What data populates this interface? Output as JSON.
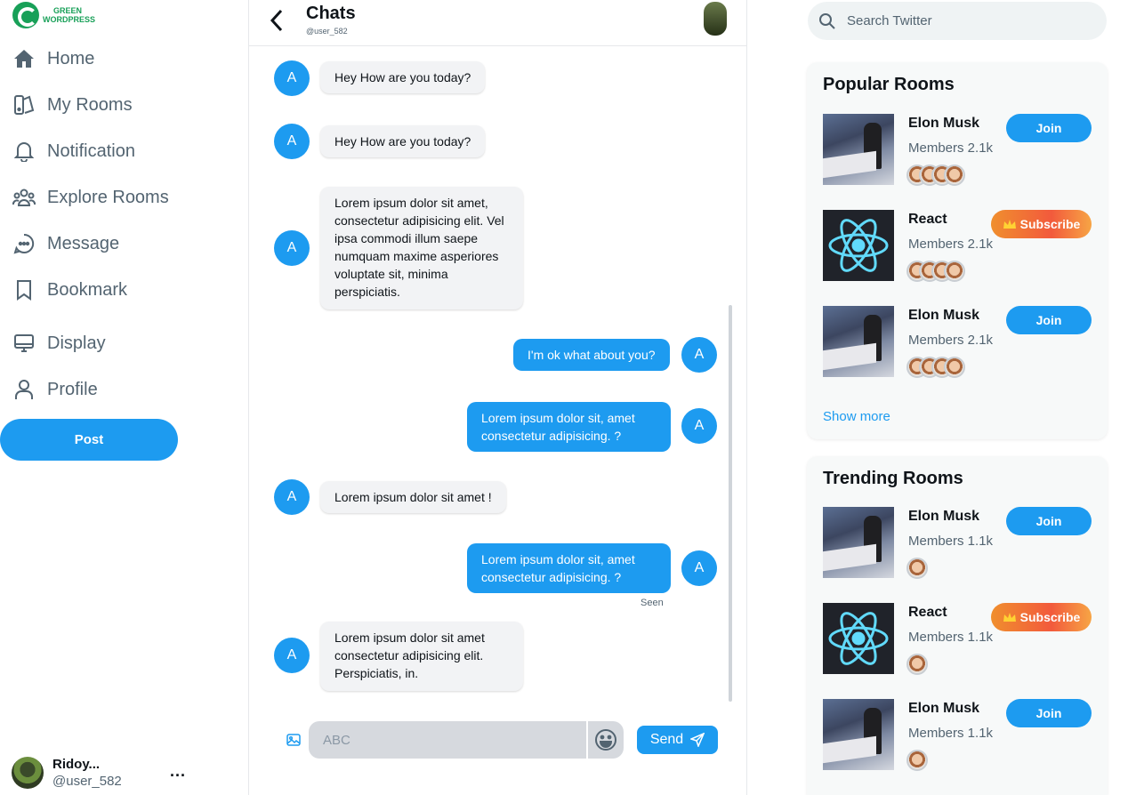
{
  "logo": {
    "line1": "GREEN",
    "line2": "WORDPRESS"
  },
  "nav": [
    {
      "label": "Home",
      "icon": "home-icon"
    },
    {
      "label": "My Rooms",
      "icon": "rooms-icon"
    },
    {
      "label": "Notification",
      "icon": "bell-icon"
    },
    {
      "label": "Explore Rooms",
      "icon": "people-icon"
    },
    {
      "label": "Message",
      "icon": "chat-bubble-icon"
    },
    {
      "label": "Bookmark",
      "icon": "bookmark-icon"
    },
    {
      "label": "Display",
      "icon": "monitor-icon"
    },
    {
      "label": "Profile",
      "icon": "user-icon"
    }
  ],
  "post_label": "Post",
  "me": {
    "name": "Ridoy...",
    "handle": "@user_582",
    "more": "..."
  },
  "chat": {
    "title": "Chats",
    "subtitle": "@user_582",
    "seen": "Seen",
    "messages": [
      {
        "side": "in",
        "avatar": "A",
        "text": "Hey How are you today?"
      },
      {
        "side": "in",
        "avatar": "A",
        "text": "Hey How are you today?"
      },
      {
        "side": "in",
        "avatar": "A",
        "text": "Lorem ipsum dolor sit amet, consectetur adipisicing elit. Vel ipsa commodi illum saepe numquam maxime asperiores voluptate sit, minima perspiciatis."
      },
      {
        "side": "out",
        "avatar": "A",
        "text": "I'm ok what about you?"
      },
      {
        "side": "out",
        "avatar": "A",
        "text": "Lorem ipsum dolor sit, amet consectetur adipisicing. ?"
      },
      {
        "side": "in",
        "avatar": "A",
        "text": "Lorem ipsum dolor sit amet !"
      },
      {
        "side": "out",
        "avatar": "A",
        "text": "Lorem ipsum dolor sit, amet consectetur adipisicing. ?"
      },
      {
        "side": "in",
        "avatar": "A",
        "text": "Lorem ipsum dolor sit amet consectetur adipisicing elit. Perspiciatis, in."
      }
    ],
    "composer": {
      "placeholder": "ABC",
      "send_label": "Send"
    }
  },
  "search": {
    "placeholder": "Search Twitter"
  },
  "popular": {
    "title": "Popular Rooms",
    "show_more": "Show more",
    "rooms": [
      {
        "name": "Elon Musk",
        "members": "Members 2.1k",
        "action": "Join"
      },
      {
        "name": "React",
        "members": "Members 2.1k",
        "action": "Subscribe"
      },
      {
        "name": "Elon Musk",
        "members": "Members 2.1k",
        "action": "Join"
      }
    ]
  },
  "trending": {
    "title": "Trending Rooms",
    "rooms": [
      {
        "name": "Elon Musk",
        "members": "Members 1.1k",
        "action": "Join"
      },
      {
        "name": "React",
        "members": "Members 1.1k",
        "action": "Subscribe"
      },
      {
        "name": "Elon Musk",
        "members": "Members 1.1k",
        "action": "Join"
      }
    ]
  },
  "colors": {
    "accent": "#1d9bf0",
    "brand": "#18a058"
  }
}
